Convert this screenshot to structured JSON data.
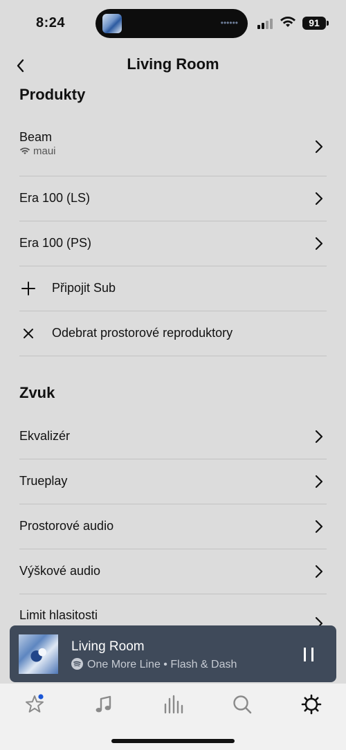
{
  "status_bar": {
    "time": "8:24",
    "battery": "91",
    "island_dots": "••••••"
  },
  "header": {
    "title": "Living Room",
    "back_icon": "chevron-left-icon"
  },
  "products": {
    "title": "Produkty",
    "items": [
      {
        "label": "Beam",
        "sub": "maui",
        "sub_icon": "wifi-icon",
        "icon": "chevron-right-icon"
      },
      {
        "label": "Era 100 (LS)",
        "icon": "chevron-right-icon"
      },
      {
        "label": "Era 100 (PS)",
        "icon": "chevron-right-icon"
      }
    ],
    "actions": [
      {
        "label": "Připojit Sub",
        "icon": "plus-icon"
      },
      {
        "label": "Odebrat prostorové reproduktory",
        "icon": "close-icon"
      }
    ]
  },
  "sound": {
    "title": "Zvuk",
    "items": [
      {
        "label": "Ekvalizér",
        "icon": "chevron-right-icon"
      },
      {
        "label": "Trueplay",
        "icon": "chevron-right-icon"
      },
      {
        "label": "Prostorové audio",
        "icon": "chevron-right-icon"
      },
      {
        "label": "Výškové audio",
        "icon": "chevron-right-icon"
      },
      {
        "label": "Limit hlasitosti",
        "icon": "chevron-right-icon"
      }
    ]
  },
  "now_playing": {
    "room": "Living Room",
    "track": "One More Line",
    "separator": "•",
    "artist": "Flash & Dash",
    "service_icon": "spotify-icon",
    "control_icon": "pause-icon"
  },
  "tab_bar": {
    "tabs": [
      {
        "icon": "star-icon",
        "badge": true
      },
      {
        "icon": "music-note-icon"
      },
      {
        "icon": "rooms-icon"
      },
      {
        "icon": "search-icon"
      },
      {
        "icon": "settings-gear-icon",
        "active": true
      }
    ],
    "badge_color": "#1a56d6"
  },
  "colors": {
    "background": "#dcdcdc",
    "player_background": "#3f4a5a",
    "tab_bar_background": "#f1f1f1"
  }
}
